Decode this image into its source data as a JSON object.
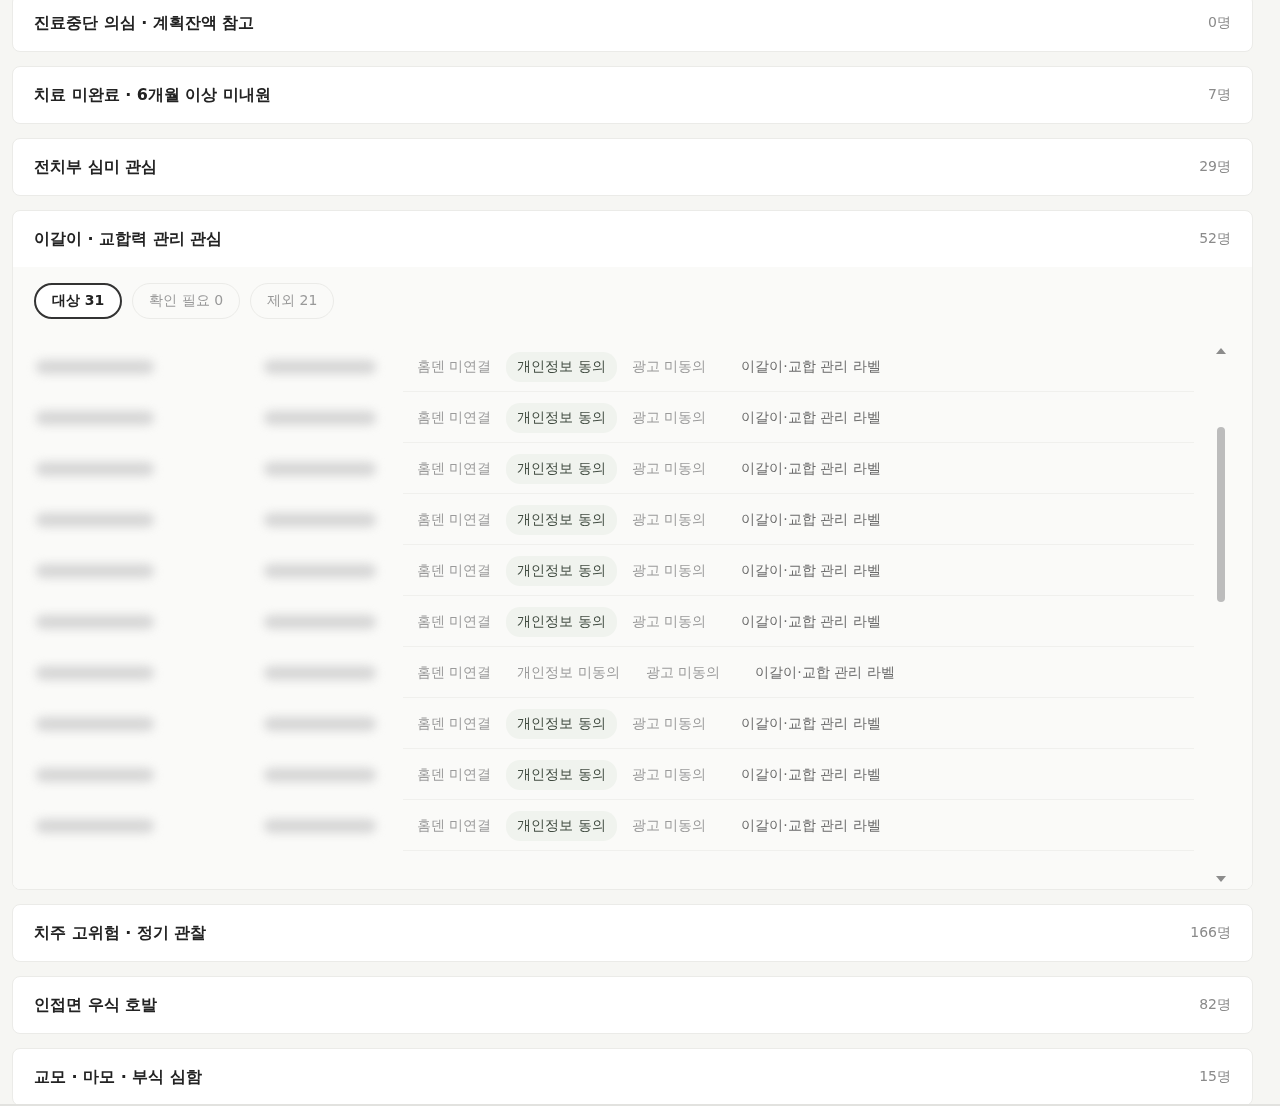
{
  "groups": [
    {
      "title": "진료중단 의심 · 계획잔액 참고",
      "count": "0명",
      "expanded": false
    },
    {
      "title": "치료 미완료 · 6개월 이상 미내원",
      "count": "7명",
      "expanded": false
    },
    {
      "title": "전치부 심미 관심",
      "count": "29명",
      "expanded": false
    },
    {
      "title": "이갈이 · 교합력 관리 관심",
      "count": "52명",
      "expanded": true,
      "filters": [
        {
          "label": "대상 31",
          "selected": true
        },
        {
          "label": "확인 필요 0",
          "selected": false
        },
        {
          "label": "제외 21",
          "selected": false
        }
      ],
      "patients": [
        {
          "home": "홈덴 미연결",
          "privacy": "개인정보 동의",
          "privacy_consented": true,
          "ad": "광고 미동의",
          "label": "이갈이·교합 관리 라벨"
        },
        {
          "home": "홈덴 미연결",
          "privacy": "개인정보 동의",
          "privacy_consented": true,
          "ad": "광고 미동의",
          "label": "이갈이·교합 관리 라벨"
        },
        {
          "home": "홈덴 미연결",
          "privacy": "개인정보 동의",
          "privacy_consented": true,
          "ad": "광고 미동의",
          "label": "이갈이·교합 관리 라벨"
        },
        {
          "home": "홈덴 미연결",
          "privacy": "개인정보 동의",
          "privacy_consented": true,
          "ad": "광고 미동의",
          "label": "이갈이·교합 관리 라벨"
        },
        {
          "home": "홈덴 미연결",
          "privacy": "개인정보 동의",
          "privacy_consented": true,
          "ad": "광고 미동의",
          "label": "이갈이·교합 관리 라벨"
        },
        {
          "home": "홈덴 미연결",
          "privacy": "개인정보 동의",
          "privacy_consented": true,
          "ad": "광고 미동의",
          "label": "이갈이·교합 관리 라벨"
        },
        {
          "home": "홈덴 미연결",
          "privacy": "개인정보 미동의",
          "privacy_consented": false,
          "ad": "광고 미동의",
          "label": "이갈이·교합 관리 라벨"
        },
        {
          "home": "홈덴 미연결",
          "privacy": "개인정보 동의",
          "privacy_consented": true,
          "ad": "광고 미동의",
          "label": "이갈이·교합 관리 라벨"
        },
        {
          "home": "홈덴 미연결",
          "privacy": "개인정보 동의",
          "privacy_consented": true,
          "ad": "광고 미동의",
          "label": "이갈이·교합 관리 라벨"
        },
        {
          "home": "홈덴 미연결",
          "privacy": "개인정보 동의",
          "privacy_consented": true,
          "ad": "광고 미동의",
          "label": "이갈이·교합 관리 라벨"
        }
      ]
    },
    {
      "title": "치주 고위험 · 정기 관찰",
      "count": "166명",
      "expanded": false
    },
    {
      "title": "인접면 우식 호발",
      "count": "82명",
      "expanded": false
    },
    {
      "title": "교모 · 마모 · 부식 심함",
      "count": "15명",
      "expanded": false
    }
  ]
}
